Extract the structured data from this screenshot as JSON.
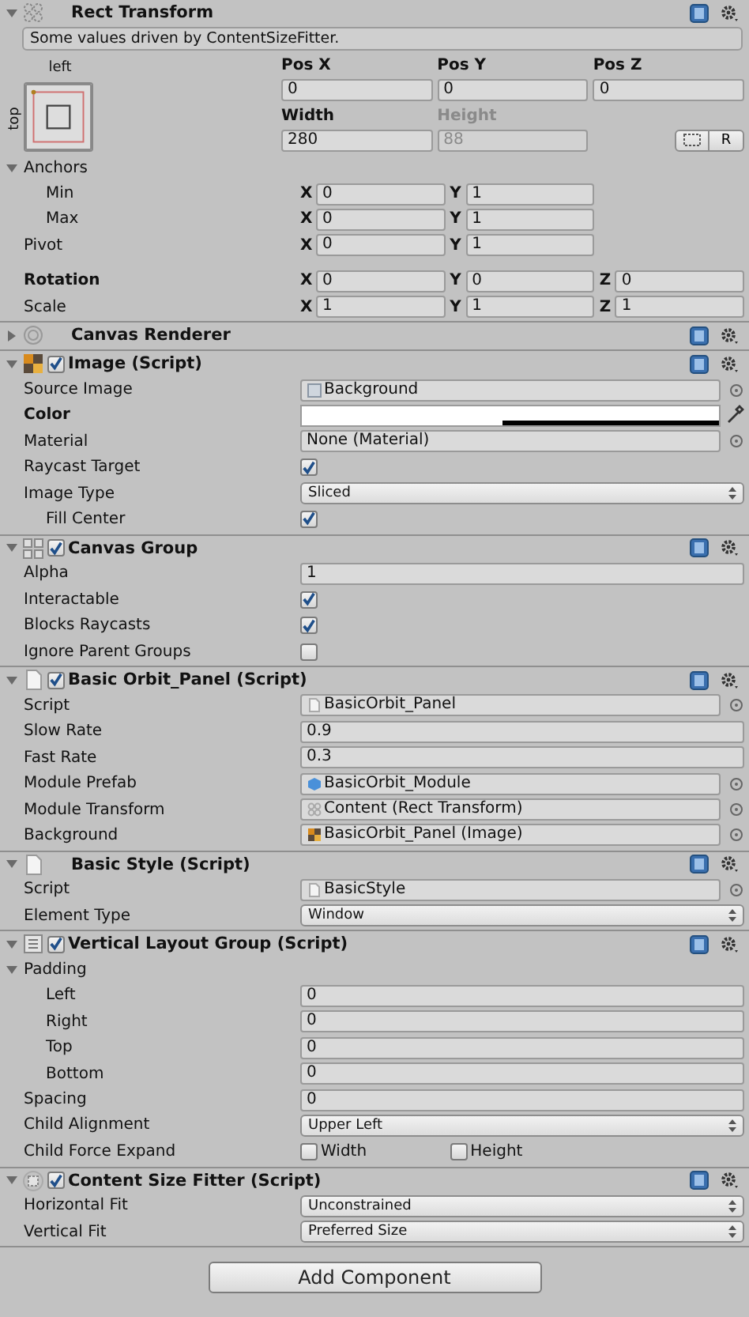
{
  "rect_transform": {
    "kind": "rect-transform",
    "title": "Rect Transform",
    "expanded": true,
    "note": "Some values driven by ContentSizeFitter.",
    "anchor_preset": {
      "horizontal": "left",
      "vertical": "top"
    },
    "position": [
      {
        "label": "Pos X",
        "value": "0",
        "disabled": false
      },
      {
        "label": "Pos Y",
        "value": "0",
        "disabled": false
      },
      {
        "label": "Pos Z",
        "value": "0",
        "disabled": false
      }
    ],
    "size": [
      {
        "label": "Width",
        "value": "280",
        "disabled": false
      },
      {
        "label": "Height",
        "value": "88",
        "disabled": true
      }
    ],
    "raw_button": "R",
    "rows": [
      {
        "kind": "foldout",
        "label": "Anchors",
        "expanded": true,
        "children": [
          {
            "kind": "vector",
            "label": "Min",
            "fields": [
              {
                "axis": "X",
                "value": "0"
              },
              {
                "axis": "Y",
                "value": "1"
              }
            ]
          },
          {
            "kind": "vector",
            "label": "Max",
            "fields": [
              {
                "axis": "X",
                "value": "0"
              },
              {
                "axis": "Y",
                "value": "1"
              }
            ]
          }
        ]
      },
      {
        "kind": "vector",
        "label": "Pivot",
        "fields": [
          {
            "axis": "X",
            "value": "0"
          },
          {
            "axis": "Y",
            "value": "1"
          }
        ]
      },
      {
        "kind": "gap"
      },
      {
        "kind": "vector",
        "label": "Rotation",
        "overridden": true,
        "fields": [
          {
            "axis": "X",
            "value": "0"
          },
          {
            "axis": "Y",
            "value": "0"
          },
          {
            "axis": "Z",
            "value": "0"
          }
        ]
      },
      {
        "kind": "vector",
        "label": "Scale",
        "fields": [
          {
            "axis": "X",
            "value": "1"
          },
          {
            "axis": "Y",
            "value": "1"
          },
          {
            "axis": "Z",
            "value": "1"
          }
        ]
      }
    ]
  },
  "components": [
    {
      "kind": "canvas-renderer",
      "title": "Canvas Renderer",
      "expanded": false
    },
    {
      "kind": "image",
      "title": "Image (Script)",
      "expanded": true,
      "enabled": true,
      "rows": [
        {
          "kind": "object-sprite",
          "label": "Source Image",
          "value": "Background"
        },
        {
          "kind": "color",
          "label": "Color",
          "overridden": true,
          "color": "#ffffff",
          "level": 0.48
        },
        {
          "kind": "object-none",
          "label": "Material",
          "value": "None (Material)"
        },
        {
          "kind": "checkbox",
          "label": "Raycast Target",
          "checked": true
        },
        {
          "kind": "dropdown",
          "label": "Image Type",
          "value": "Sliced",
          "children": [
            {
              "kind": "checkbox",
              "label": "Fill Center",
              "checked": true
            }
          ]
        }
      ]
    },
    {
      "kind": "canvas-group",
      "title": "Canvas Group",
      "expanded": true,
      "enabled": true,
      "rows": [
        {
          "kind": "field",
          "label": "Alpha",
          "value": "1"
        },
        {
          "kind": "checkbox",
          "label": "Interactable",
          "checked": true
        },
        {
          "kind": "checkbox",
          "label": "Blocks Raycasts",
          "checked": true
        },
        {
          "kind": "checkbox",
          "label": "Ignore Parent Groups",
          "checked": false
        }
      ]
    },
    {
      "kind": "script",
      "title": "Basic Orbit_Panel (Script)",
      "expanded": true,
      "enabled": true,
      "rows": [
        {
          "kind": "object-script",
          "label": "Script",
          "value": "BasicOrbit_Panel"
        },
        {
          "kind": "field",
          "label": "Slow Rate",
          "value": "0.9"
        },
        {
          "kind": "field",
          "label": "Fast Rate",
          "value": "0.3"
        },
        {
          "kind": "object-prefab",
          "label": "Module Prefab",
          "value": "BasicOrbit_Module"
        },
        {
          "kind": "object-transform",
          "label": "Module Transform",
          "value": "Content (Rect Transform)"
        },
        {
          "kind": "object-image",
          "label": "Background",
          "value": "BasicOrbit_Panel (Image)"
        }
      ]
    },
    {
      "kind": "script",
      "title": "Basic Style (Script)",
      "expanded": true,
      "rows": [
        {
          "kind": "object-script",
          "label": "Script",
          "value": "BasicStyle"
        },
        {
          "kind": "dropdown",
          "label": "Element Type",
          "value": "Window"
        }
      ]
    },
    {
      "kind": "layout",
      "title": "Vertical Layout Group (Script)",
      "expanded": true,
      "enabled": true,
      "rows": [
        {
          "kind": "foldout",
          "label": "Padding",
          "expanded": true,
          "children": [
            {
              "kind": "field",
              "label": "Left",
              "value": "0"
            },
            {
              "kind": "field",
              "label": "Right",
              "value": "0"
            },
            {
              "kind": "field",
              "label": "Top",
              "value": "0"
            },
            {
              "kind": "field",
              "label": "Bottom",
              "value": "0"
            }
          ]
        },
        {
          "kind": "field",
          "label": "Spacing",
          "value": "0"
        },
        {
          "kind": "dropdown",
          "label": "Child Alignment",
          "value": "Upper Left"
        },
        {
          "kind": "toggles",
          "label": "Child Force Expand",
          "options": [
            {
              "label": "Width",
              "checked": false
            },
            {
              "label": "Height",
              "checked": false
            }
          ]
        }
      ]
    },
    {
      "kind": "fitter",
      "title": "Content Size Fitter (Script)",
      "expanded": true,
      "enabled": true,
      "rows": [
        {
          "kind": "dropdown",
          "label": "Horizontal Fit",
          "value": "Unconstrained"
        },
        {
          "kind": "dropdown",
          "label": "Vertical Fit",
          "value": "Preferred Size"
        }
      ]
    }
  ],
  "add_button": "Add Component"
}
